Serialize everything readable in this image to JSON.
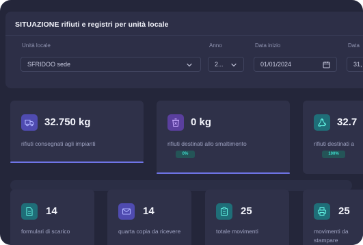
{
  "panel": {
    "title": "SITUAZIONE rifiuti e registri per unità locale",
    "fields": {
      "unit_label": "Unità locale",
      "unit_value": "SFRIDOO sede",
      "year_label": "Anno",
      "year_value": "2...",
      "start_label": "Data inizio",
      "start_value": "01/01/2024",
      "end_label": "Data",
      "end_value": "31,"
    }
  },
  "kpis": [
    {
      "value": "32.750 kg",
      "label": "rifiuti consegnati agli impianti",
      "badge": "",
      "icon": "truck-icon"
    },
    {
      "value": "0 kg",
      "label": "rifiuti destinati allo smaltimento",
      "badge": "0%",
      "icon": "trash-icon"
    },
    {
      "value": "32.7",
      "label": "rifiuti destinati a",
      "badge": "100%",
      "icon": "recycle-icon"
    }
  ],
  "stats": [
    {
      "value": "14",
      "label": "formulari di scarico",
      "icon": "document-icon"
    },
    {
      "value": "14",
      "label": "quarta copia da ricevere",
      "icon": "mail-icon"
    },
    {
      "value": "25",
      "label": "totale movimenti",
      "icon": "clipboard-icon"
    },
    {
      "value": "25",
      "label": "movimenti da stampare",
      "icon": "printer-icon"
    }
  ],
  "colors": {
    "background": "#24263a",
    "card": "#2f3149",
    "accent": "#6f74e6",
    "teal": "#3ee0d0"
  }
}
